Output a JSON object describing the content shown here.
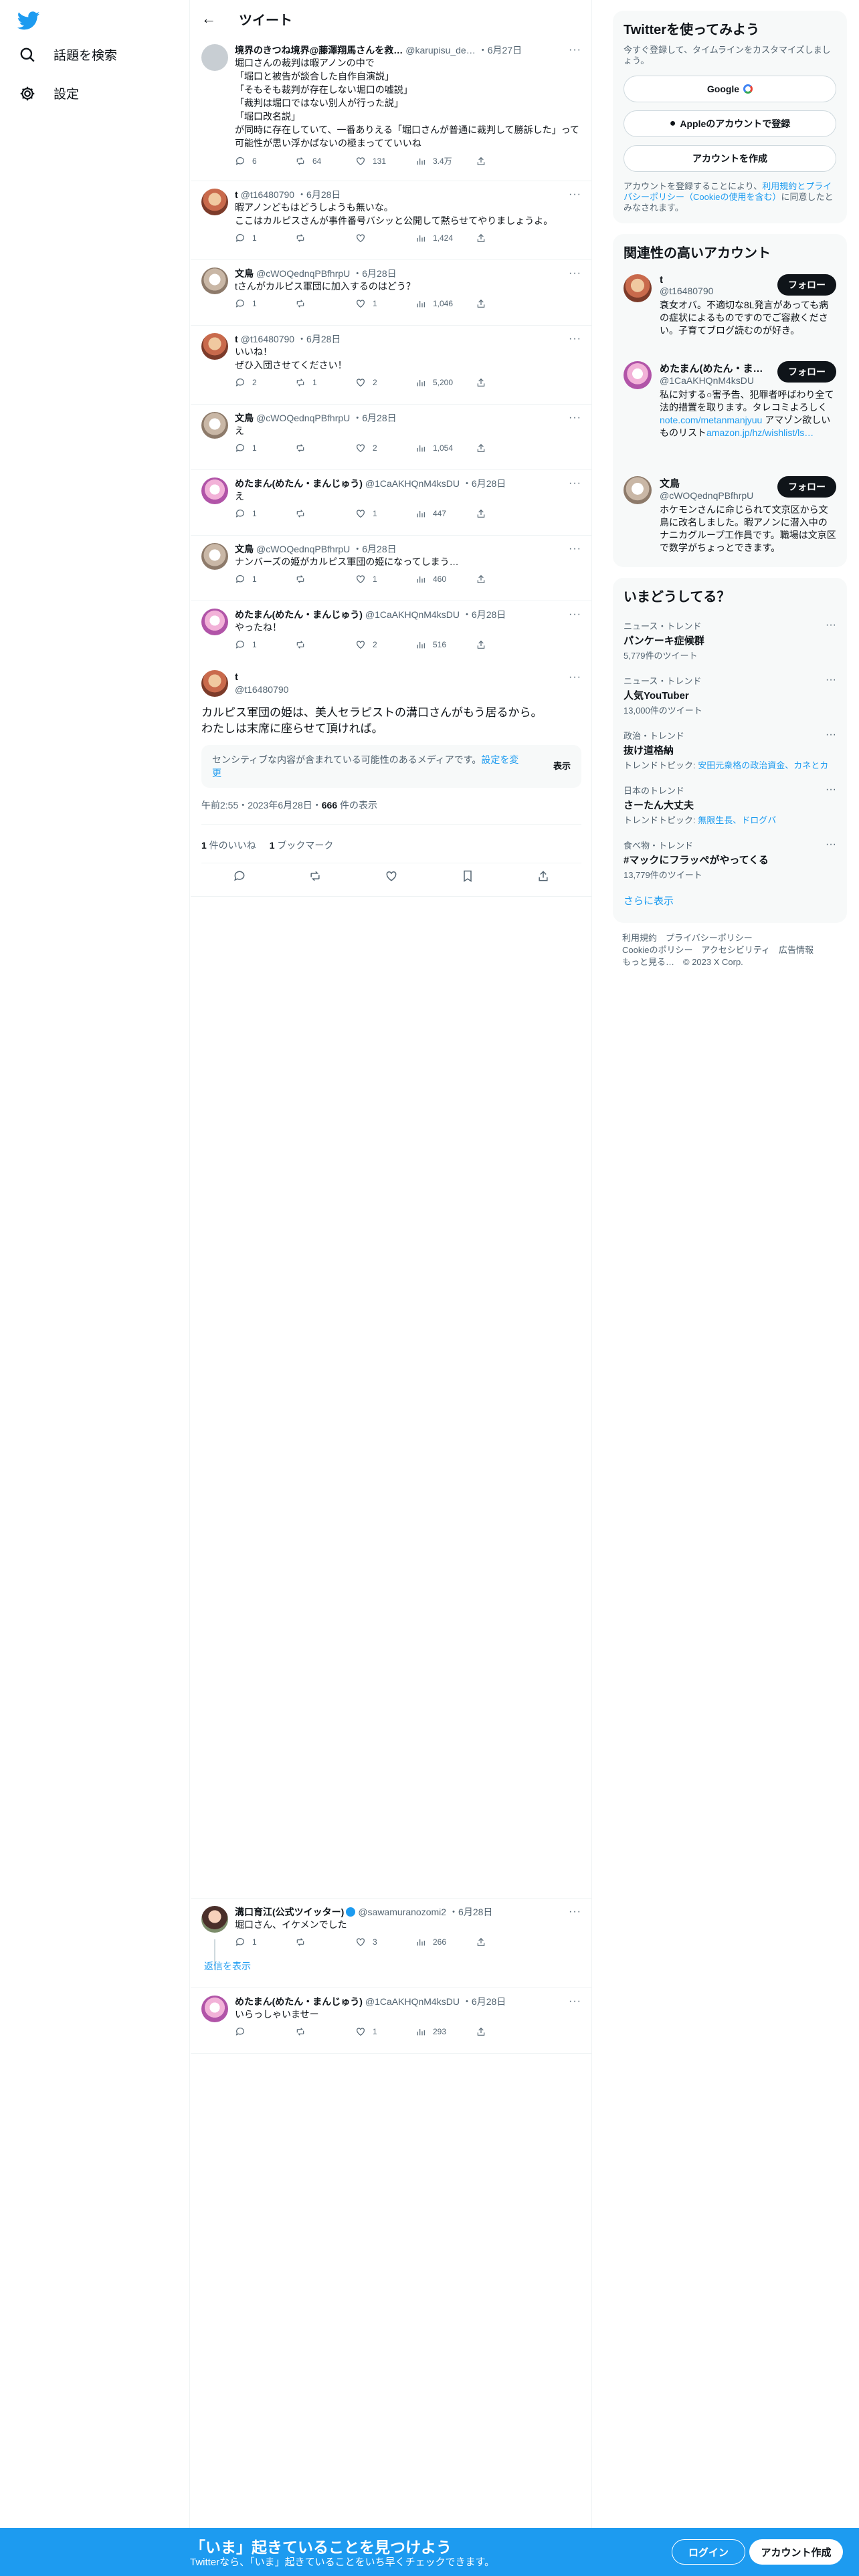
{
  "nav": {
    "explore": "話題を検索",
    "settings": "設定"
  },
  "header": {
    "back": "←",
    "title": "ツイート"
  },
  "tweets": [
    {
      "name": "境界のきつね境界@藤澤翔馬さんを救…",
      "handle": "@karupisu_de…",
      "date": "・6月27日",
      "text": "堀口さんの裁判は暇アノンの中で\n「堀口と被告が談合した自作自演説」\n「そもそも裁判が存在しない堀口の嘘説」\n「裁判は堀口ではない別人が行った説」\n「堀口改名説」\nが同時に存在していて、一番ありえる「堀口さんが普通に裁判して勝訴した」って可能性が思い浮かばないの極まってていいね",
      "reply": "6",
      "rt": "64",
      "like": "131",
      "views": "3.4万"
    },
    {
      "name": "t",
      "handle": "@t16480790",
      "date": "・6月28日",
      "text": "暇アノンどもはどうしようも無いな。\nここはカルピスさんが事件番号バシッと公開して黙らせてやりましょうよ。",
      "reply": "1",
      "rt": "",
      "like": "",
      "views": "1,424"
    },
    {
      "name": "文鳥",
      "handle": "@cWOQednqPBfhrpU",
      "date": "・6月28日",
      "text": "tさんがカルピス軍団に加入するのはどう？",
      "reply": "1",
      "rt": "",
      "like": "1",
      "views": "1,046"
    },
    {
      "name": "t",
      "handle": "@t16480790",
      "date": "・6月28日",
      "text": "いいね！\nぜひ入団させてください！",
      "reply": "2",
      "rt": "1",
      "like": "2",
      "views": "5,200"
    },
    {
      "name": "文鳥",
      "handle": "@cWOQednqPBfhrpU",
      "date": "・6月28日",
      "text": "え",
      "reply": "1",
      "rt": "",
      "like": "2",
      "views": "1,054"
    },
    {
      "name": "めたまん(めたん・まんじゅう)",
      "handle": "@1CaAKHQnM4ksDU",
      "date": "・6月28日",
      "text": "え",
      "reply": "1",
      "rt": "",
      "like": "1",
      "views": "447"
    },
    {
      "name": "文鳥",
      "handle": "@cWOQednqPBfhrpU",
      "date": "・6月28日",
      "text": "ナンバーズの姫がカルピス軍団の姫になってしまう…",
      "reply": "1",
      "rt": "",
      "like": "1",
      "views": "460"
    },
    {
      "name": "めたまん(めたん・まんじゅう)",
      "handle": "@1CaAKHQnM4ksDU",
      "date": "・6月28日",
      "text": "やったね！",
      "reply": "1",
      "rt": "",
      "like": "2",
      "views": "516"
    }
  ],
  "focus": {
    "name": "t",
    "handle": "@t16480790",
    "text": "カルピス軍団の姫は、美人セラピストの溝口さんがもう居るから。\nわたしは末席に座らせて頂ければ。",
    "sensitive": "センシティブな内容が含まれている可能性のあるメディアです。",
    "sensitive_link": "設定を変更",
    "show": "表示",
    "time": "午前2:55・2023年6月28日・",
    "views_num": "666",
    "views_label": " 件の表示",
    "likes_num": "1",
    "likes_label": " 件のいいね",
    "bookmarks_num": "1",
    "bookmarks_label": " ブックマーク"
  },
  "replies": [
    {
      "name": "溝口育江(公式ツイッター)",
      "handle": "@sawamuranozomi2",
      "date": "・6月28日",
      "text": "堀口さん、イケメンでした",
      "reply": "1",
      "rt": "",
      "like": "3",
      "views": "266",
      "show_thread": "返信を表示"
    },
    {
      "name": "めたまん(めたん・まんじゅう)",
      "handle": "@1CaAKHQnM4ksDU",
      "date": "・6月28日",
      "text": "いらっしゃいませー",
      "reply": "",
      "rt": "",
      "like": "1",
      "views": "293"
    }
  ],
  "signup": {
    "title": "Twitterを使ってみよう",
    "sub": "今すぐ登録して、タイムラインをカスタマイズしましょう。",
    "google": "Google",
    "apple": "Appleのアカウントで登録",
    "create": "アカウントを作成",
    "terms_pre": "アカウントを登録することにより、",
    "terms_link": "利用規約とプライバシーポリシー（Cookieの使用を含む）",
    "terms_post": "に同意したとみなされます。"
  },
  "related": {
    "title": "関連性の高いアカウント",
    "follow": "フォロー",
    "users": [
      {
        "name": "t",
        "handle": "@t16480790",
        "bio": "衰女オバ。不適切な8L発言があっても病の症状によるものですのでご容赦ください。子育てブログ読むのが好き。"
      },
      {
        "name": "めたまん(めたん・ま…",
        "handle": "@1CaAKHQnM4ksDU",
        "bio": "私に対する○害予告、犯罪者呼ばわり全て法的措置を取ります。タレコミよろしく",
        "link1": "note.com/metanmanjyuu",
        "bio2": " アマゾン欲しいものリスト",
        "link2": "amazon.jp/hz/wishlist/ls…"
      },
      {
        "name": "文鳥",
        "handle": "@cWOQednqPBfhrpU",
        "bio": "ホケモンさんに命じられて文京区から文鳥に改名しました。暇アノンに潜入中のナニカグループ工作員です。職場は文京区で数学がちょっとできます。"
      }
    ]
  },
  "trends": {
    "title": "いまどうしてる？",
    "items": [
      {
        "cat": "ニュース・トレンド",
        "title": "パンケーキ症候群",
        "cnt": "5,779件のツイート"
      },
      {
        "cat": "ニュース・トレンド",
        "title": "人気YouTuber",
        "cnt": "13,000件のツイート"
      },
      {
        "cat": "政治・トレンド",
        "title": "抜け道格納",
        "cnt_pre": "トレンドトピック: ",
        "cnt_link": "安田元衆格の政治資金、カネとカ"
      },
      {
        "cat": "日本のトレンド",
        "title": "さーたん大丈夫",
        "cnt_pre": "トレンドトピック: ",
        "cnt_link": "無限生長、ドログバ"
      },
      {
        "cat": "食べ物・トレンド",
        "title": "#マックにフラッペがやってくる",
        "cnt": "13,779件のツイート"
      }
    ],
    "more": "さらに表示"
  },
  "footer": {
    "line1": "利用規約　プライバシーポリシー",
    "line2": "Cookieのポリシー　アクセシビリティ　広告情報",
    "line3": "もっと見る…　© 2023 X Corp."
  },
  "bottom": {
    "title": "「いま」起きていることを見つけよう",
    "sub": "Twitterなら、「いま」起きていることをいち早くチェックできます。",
    "login": "ログイン",
    "signup": "アカウント作成"
  }
}
